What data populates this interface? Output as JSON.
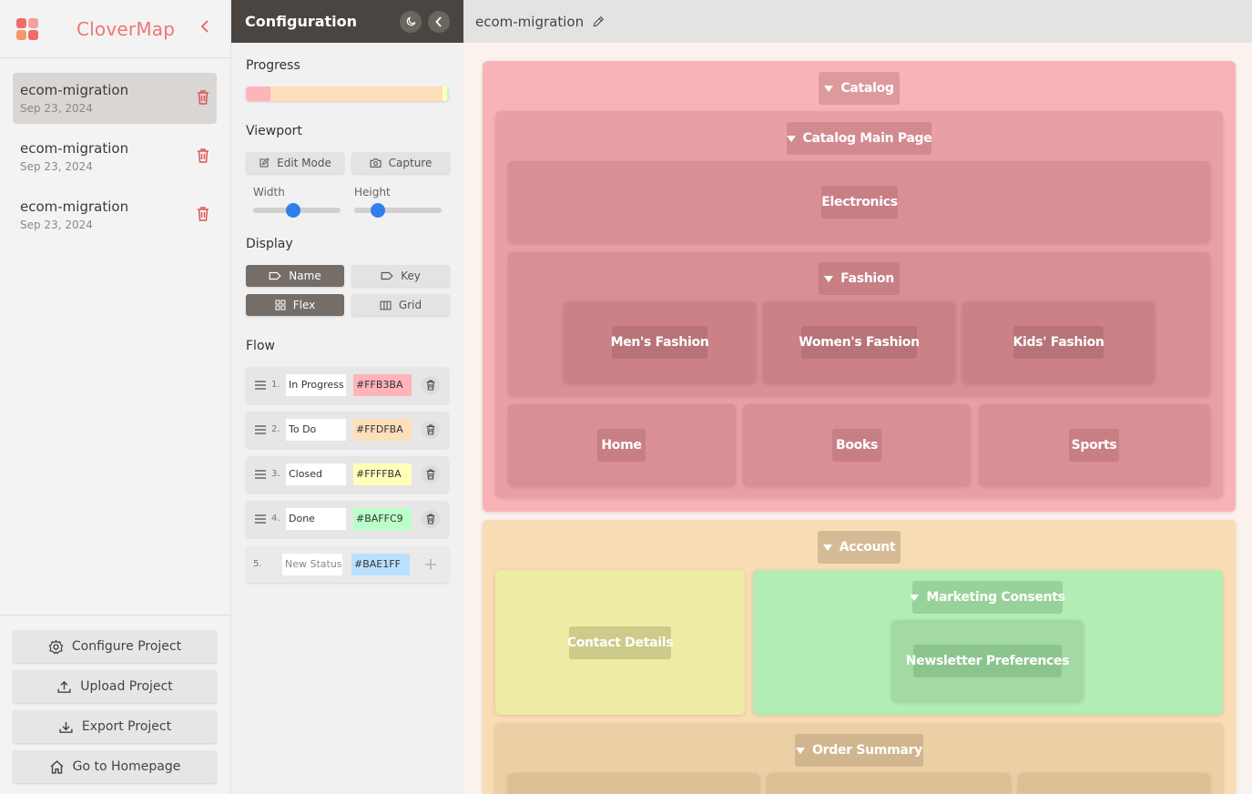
{
  "brand": {
    "name": "CloverMap"
  },
  "projects": [
    {
      "name": "ecom-migration",
      "date": "Sep 23, 2024"
    },
    {
      "name": "ecom-migration",
      "date": "Sep 23, 2024"
    },
    {
      "name": "ecom-migration",
      "date": "Sep 23, 2024"
    }
  ],
  "sidebar_actions": {
    "configure": "Configure Project",
    "upload": "Upload Project",
    "export": "Export Project",
    "home": "Go to Homepage"
  },
  "config": {
    "title": "Configuration",
    "progress_label": "Progress",
    "progress_fractions": [
      0.12,
      0.85,
      0.02,
      0.01
    ],
    "viewport_label": "Viewport",
    "edit_mode": "Edit Mode",
    "capture": "Capture",
    "width_label": "Width",
    "height_label": "Height",
    "width_value": 0.45,
    "height_value": 0.22,
    "display_label": "Display",
    "display_name": "Name",
    "display_key": "Key",
    "display_flex": "Flex",
    "display_grid": "Grid",
    "flow_label": "Flow",
    "flow": [
      {
        "num": "1.",
        "name": "In Progress",
        "color": "#FFB3BA"
      },
      {
        "num": "2.",
        "name": "To Do",
        "color": "#FFDFBA"
      },
      {
        "num": "3.",
        "name": "Closed",
        "color": "#FFFFBA"
      },
      {
        "num": "4.",
        "name": "Done",
        "color": "#BAFFC9"
      }
    ],
    "new_status": {
      "num": "5.",
      "placeholder": "New Status",
      "color": "#BAE1FF"
    }
  },
  "canvas": {
    "page_title": "ecom-migration",
    "catalog": "Catalog",
    "catalog_main": "Catalog Main Page",
    "electronics": "Electronics",
    "fashion": "Fashion",
    "mens": "Men's Fashion",
    "womens": "Women's Fashion",
    "kids": "Kids' Fashion",
    "home": "Home",
    "books": "Books",
    "sports": "Sports",
    "account": "Account",
    "contact": "Contact Details",
    "marketing": "Marketing Consents",
    "newsletter": "Newsletter Preferences",
    "order_summary": "Order Summary"
  },
  "colors": {
    "accent": "#ef6b6b",
    "config_header": "#4a4540",
    "slider_thumb": "#2f80ed"
  }
}
